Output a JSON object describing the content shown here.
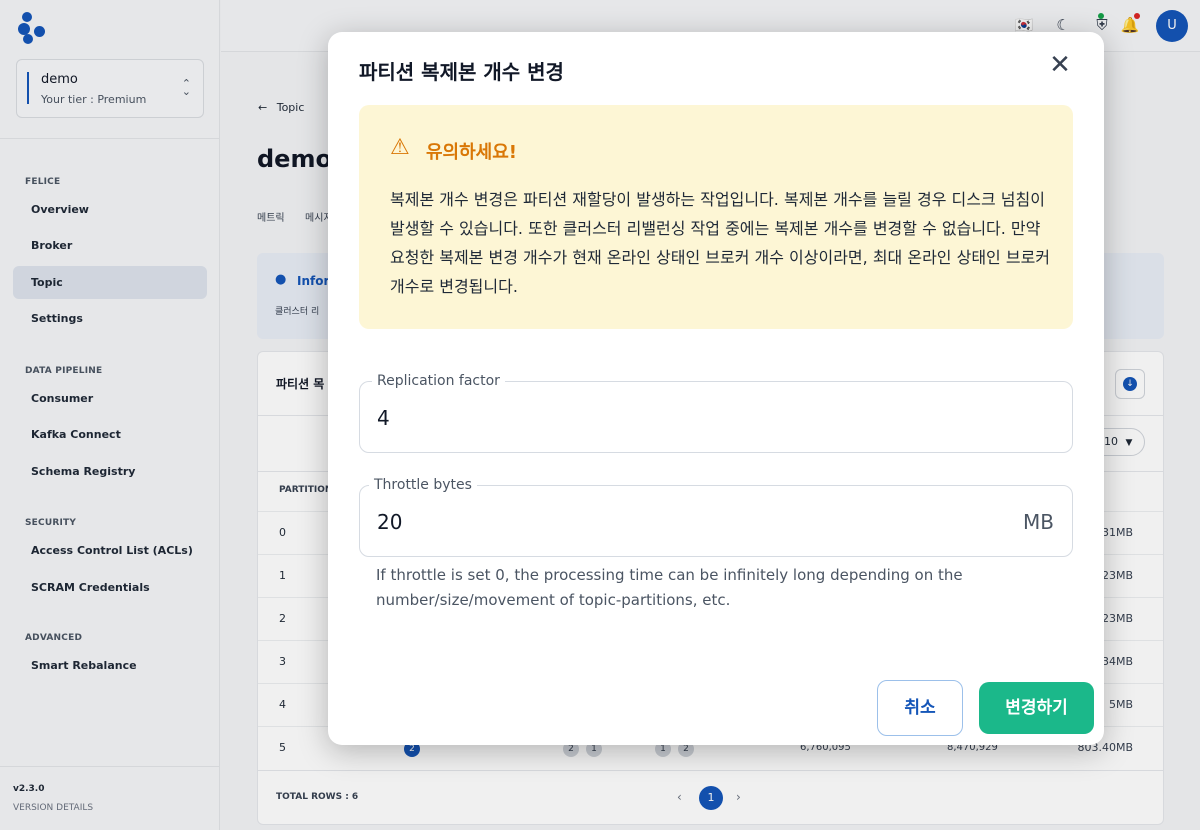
{
  "sidebar": {
    "tenant_name": "demo",
    "tenant_tier": "Your tier : Premium",
    "sections": [
      {
        "title": "FELICE",
        "items": [
          "Overview",
          "Broker",
          "Topic",
          "Settings"
        ]
      },
      {
        "title": "DATA PIPELINE",
        "items": [
          "Consumer",
          "Kafka Connect",
          "Schema Registry"
        ]
      },
      {
        "title": "SECURITY",
        "items": [
          "Access Control List (ACLs)",
          "SCRAM Credentials"
        ]
      },
      {
        "title": "ADVANCED",
        "items": [
          "Smart Rebalance"
        ]
      }
    ],
    "active_item": "Topic",
    "version": "v2.3.0",
    "version_details": "VERSION DETAILS"
  },
  "header": {
    "icons": [
      "flag-icon",
      "moon-icon",
      "badge-icon",
      "bell-icon"
    ],
    "avatar_initial": "U"
  },
  "main": {
    "back_label": "Topic",
    "page_title": "demo-",
    "tabs": [
      "메트릭",
      "메시지"
    ],
    "info_title": "Infor",
    "info_text": "클러스터 리",
    "table_title": "파티션 목",
    "per_page": "10",
    "partition_header": "PARTITION",
    "rows": [
      {
        "id": "0",
        "size": "31MB"
      },
      {
        "id": "1",
        "size": "23MB"
      },
      {
        "id": "2",
        "size": "23MB"
      },
      {
        "id": "3",
        "size": "34MB"
      },
      {
        "id": "4",
        "size": "5MB"
      },
      {
        "id": "5",
        "size": "803.40MB"
      }
    ],
    "row5": {
      "leader": "2",
      "replicas": [
        "2",
        "1"
      ],
      "isr": [
        "1",
        "2"
      ],
      "offset_a": "6,760,095",
      "offset_b": "8,470,929"
    },
    "total_rows": "TOTAL ROWS : 6",
    "current_page": "1"
  },
  "modal": {
    "title": "파티션 복제본 개수 변경",
    "warning_title": "유의하세요!",
    "warning_text": "복제본 개수 변경은 파티션 재할당이 발생하는 작업입니다. 복제본 개수를 늘릴 경우 디스크 넘침이 발생할 수 있습니다. 또한 클러스터 리밸런싱 작업 중에는 복제본 개수를 변경할 수 없습니다. 만약 요청한 복제본 변경 개수가 현재 온라인 상태인 브로커 개수 이상이라면, 최대 온라인 상태인 브로커 개수로 변경됩니다.",
    "replication_label": "Replication factor",
    "replication_value": "4",
    "throttle_label": "Throttle bytes",
    "throttle_value": "20",
    "throttle_unit": "MB",
    "helper_text": "If throttle is set 0, the processing time can be infinitely long depending on the number/size/movement of topic-partitions, etc.",
    "cancel_label": "취소",
    "submit_label": "변경하기"
  },
  "colors": {
    "brand": "#1556b8",
    "warning": "#d97706",
    "warning_bg": "#fdf6d5",
    "submit": "#1bb88a"
  }
}
